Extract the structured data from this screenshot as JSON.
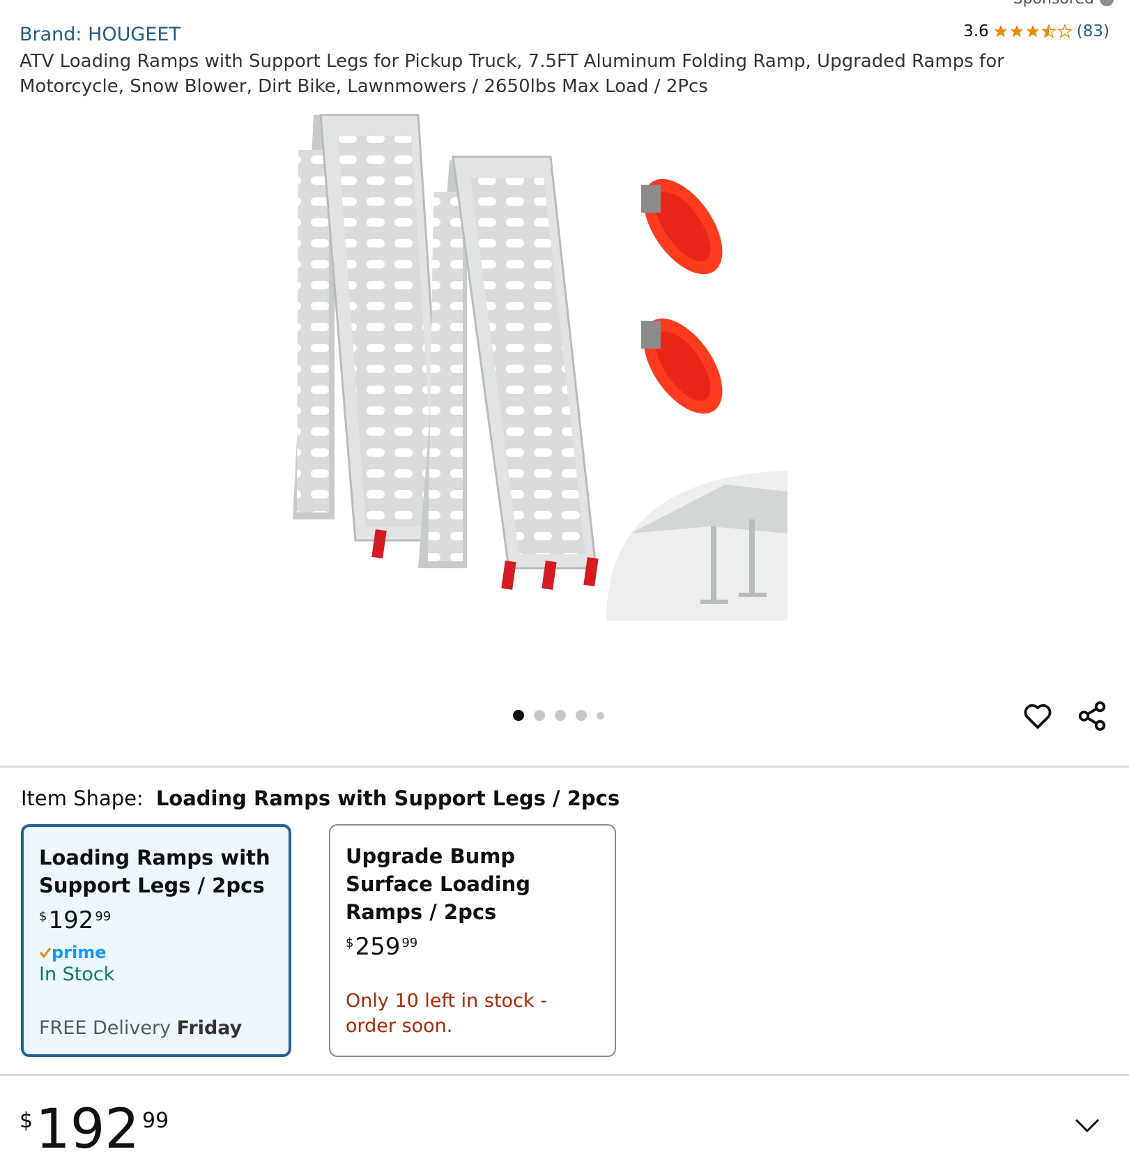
{
  "header": {
    "sponsored_label": "Sponsored",
    "brand": "Brand: HOUGEET",
    "rating_score": "3.6",
    "rating_value": 3.6,
    "rating_count": "(83)",
    "title": "ATV Loading Ramps with Support Legs for Pickup Truck, 7.5FT Aluminum Folding Ramp, Upgraded Ramps for Motorcycle, Snow Blower, Dirt Bike, Lawnmowers / 2650lbs Max Load / 2Pcs"
  },
  "gallery": {
    "total_images": 5,
    "active_index": 0
  },
  "shape": {
    "label": "Item Shape:",
    "selected_value": "Loading Ramps with Support Legs / 2pcs"
  },
  "options": [
    {
      "title": "Loading Ramps with Support Legs / 2pcs",
      "price_symbol": "$",
      "price_whole": "192",
      "price_fraction": "99",
      "prime": "prime",
      "stock": "In Stock",
      "delivery_prefix": "FREE Delivery ",
      "delivery_day": "Friday"
    },
    {
      "title": "Upgrade Bump Surface Loading Ramps / 2pcs",
      "price_symbol": "$",
      "price_whole": "259",
      "price_fraction": "99",
      "stock": "Only 10 left in stock - order soon."
    }
  ],
  "price": {
    "symbol": "$",
    "whole": "192",
    "fraction": "99"
  },
  "colors": {
    "link": "#1d5f8a",
    "star": "#f08804",
    "selected_border": "#246396",
    "in_stock": "#067d62",
    "low_stock": "#b12704",
    "prime": "#1a98ff"
  }
}
